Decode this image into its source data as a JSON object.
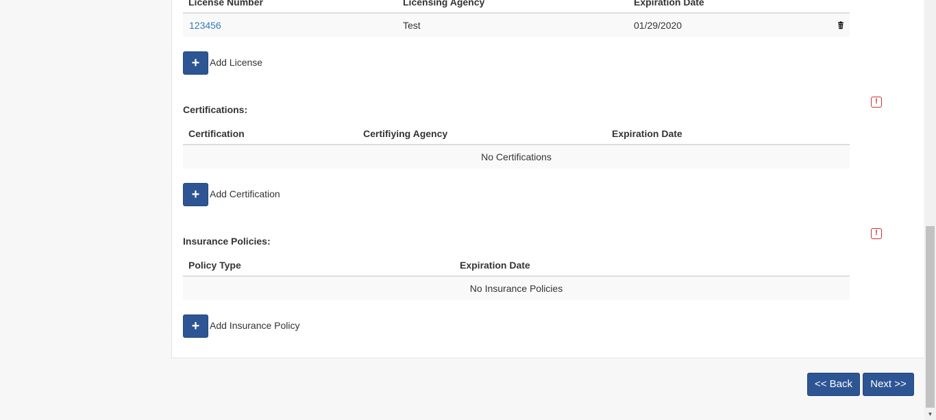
{
  "licenses": {
    "columns": {
      "number": "License Number",
      "agency": "Licensing Agency",
      "expiration": "Expiration Date"
    },
    "rows": [
      {
        "number": "123456",
        "agency": "Test",
        "expiration": "01/29/2020"
      }
    ],
    "add_label": "Add License",
    "add_icon": "+"
  },
  "certifications": {
    "title": "Certifications:",
    "columns": {
      "certification": "Certification",
      "agency": "Certifiying Agency",
      "expiration": "Expiration Date"
    },
    "empty_text": "No Certifications",
    "add_label": "Add Certification",
    "add_icon": "+",
    "alert_icon": "!"
  },
  "insurance": {
    "title": "Insurance Policies:",
    "columns": {
      "policy_type": "Policy Type",
      "expiration": "Expiration Date"
    },
    "empty_text": "No Insurance Policies",
    "add_label": "Add Insurance Policy",
    "add_icon": "+",
    "alert_icon": "!"
  },
  "navigation": {
    "back_label": "<< Back",
    "next_label": "Next >>"
  },
  "colors": {
    "primary_button": "#2e5593",
    "link": "#337ab7",
    "alert": "#c9302c",
    "row_stripe": "#f9f9f9"
  }
}
